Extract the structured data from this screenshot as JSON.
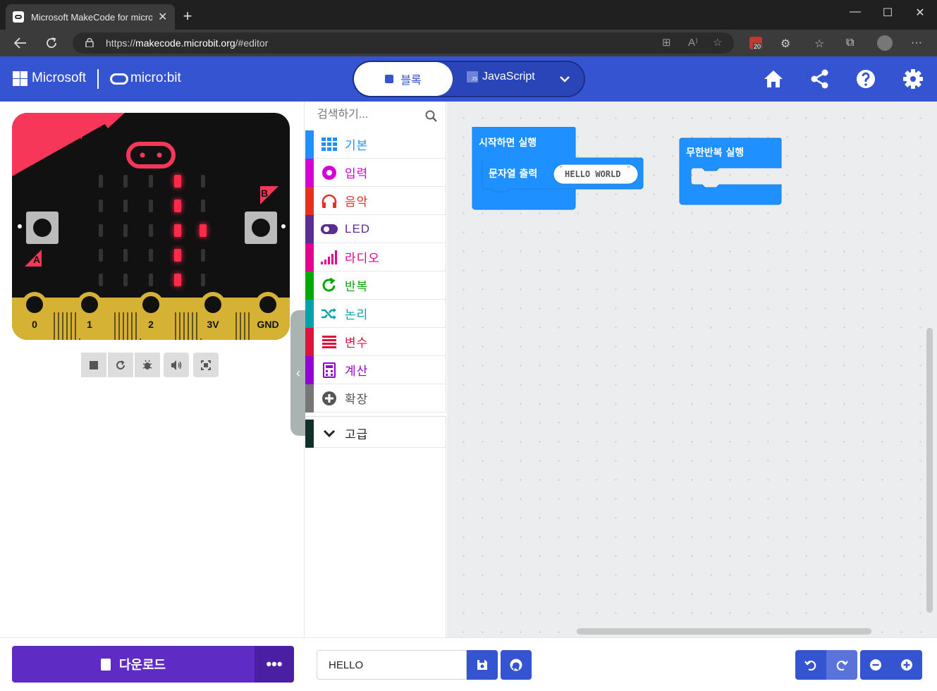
{
  "browser": {
    "tab_title": "Microsoft MakeCode for micro:bit",
    "url_prefix": "https://",
    "url_host": "makecode.microbit.org",
    "url_path": "/#editor",
    "extension_badge": "20"
  },
  "header": {
    "brand": "Microsoft",
    "product": "micro:bit",
    "blocks_label": "블록",
    "javascript_label": "JavaScript",
    "accent": "#3454d1"
  },
  "simulator": {
    "pins": [
      "0",
      "1",
      "2",
      "3V",
      "GND"
    ],
    "button_a": "A",
    "button_b": "B",
    "controls": [
      "stop-icon",
      "restart-icon",
      "debug-icon",
      "sound-icon",
      "fullscreen-icon"
    ]
  },
  "toolbox": {
    "search_placeholder": "검색하기...",
    "categories": [
      {
        "label": "기본",
        "color": "#1e90ff",
        "icon": "grid-icon"
      },
      {
        "label": "입력",
        "color": "#d400d4",
        "icon": "circle-dot-icon"
      },
      {
        "label": "음악",
        "color": "#e63022",
        "icon": "headphones-icon"
      },
      {
        "label": "LED",
        "color": "#5c2d91",
        "icon": "toggle-icon"
      },
      {
        "label": "라디오",
        "color": "#e3008c",
        "icon": "signal-icon"
      },
      {
        "label": "반복",
        "color": "#00aa00",
        "icon": "refresh-icon"
      },
      {
        "label": "논리",
        "color": "#00a4a6",
        "icon": "shuffle-icon"
      },
      {
        "label": "변수",
        "color": "#dc143c",
        "icon": "list-icon"
      },
      {
        "label": "계산",
        "color": "#9400d3",
        "icon": "calculator-icon"
      },
      {
        "label": "확장",
        "color": "#757575",
        "icon": "plus-circle-icon"
      }
    ],
    "advanced_label": "고급"
  },
  "workspace": {
    "on_start_label": "시작하면 실행",
    "show_string_label": "문자열 출력",
    "string_value": "HELLO WORLD",
    "forever_label": "무한반복 실행",
    "block_color": "#1e90ff"
  },
  "footer": {
    "download_label": "다운로드",
    "more_label": "•••",
    "project_name": "HELLO"
  }
}
